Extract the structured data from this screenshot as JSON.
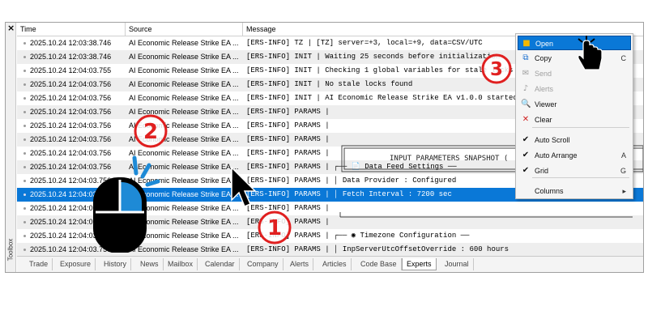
{
  "panel": {
    "close_glyph": "×",
    "toolbox_label": "Toolbox",
    "columns": {
      "time": "Time",
      "source": "Source",
      "message": "Message"
    }
  },
  "rows": [
    {
      "time": "2025.10.24 12:03:38.746",
      "source": "AI Economic Release Strike EA ...",
      "message": "[ERS-INFO] TZ | [TZ] server=+3, local=+9, data=CSV/UTC"
    },
    {
      "time": "2025.10.24 12:03:38.746",
      "source": "AI Economic Release Strike EA ...",
      "message": "[ERS-INFO] INIT | Waiting 25 seconds before initialization"
    },
    {
      "time": "2025.10.24 12:04:03.755",
      "source": "AI Economic Release Strike EA ...",
      "message": "[ERS-INFO] INIT | Checking 1 global variables for stale locks"
    },
    {
      "time": "2025.10.24 12:04:03.756",
      "source": "AI Economic Release Strike EA ...",
      "message": "[ERS-INFO] INIT | No stale locks found"
    },
    {
      "time": "2025.10.24 12:04:03.756",
      "source": "AI Economic Release Strike EA ...",
      "message": "[ERS-INFO] INIT | AI Economic Release Strike EA v1.0.0 started"
    },
    {
      "time": "2025.10.24 12:04:03.756",
      "source": "AI Economic Release Strike EA ...",
      "message": "[ERS-INFO] PARAMS |"
    },
    {
      "time": "2025.10.24 12:04:03.756",
      "source": "AI Economic Release Strike EA ...",
      "message": "[ERS-INFO] PARAMS |"
    },
    {
      "time": "2025.10.24 12:04:03.756",
      "source": "AI Economic Release Strike EA ...",
      "message": "[ERS-INFO] PARAMS |"
    },
    {
      "time": "2025.10.24 12:04:03.756",
      "source": "AI Economic Release Strike EA ...",
      "message": "[ERS-INFO] PARAMS |"
    },
    {
      "time": "2025.10.24 12:04:03.756",
      "source": "AI Economic Release Strike EA ...",
      "message": "[ERS-INFO] PARAMS |  ┌── 📄 Data Feed Settings ──"
    },
    {
      "time": "2025.10.24 12:04:03.756",
      "source": "AI Economic Release Strike EA ...",
      "message": "[ERS-INFO] PARAMS |  │ Data Provider       : Configured"
    },
    {
      "time": "2025.10.24 12:04:03.756",
      "source": "AI Economic Release Strike EA ...",
      "message": "[ERS-INFO] PARAMS |  │ Fetch Interval      : 7200 sec"
    },
    {
      "time": "2025.10.24 12:04:03.756",
      "source": "AI Economic Release Strike EA ...",
      "message": "[ERS-INFO] PARAMS |"
    },
    {
      "time": "2025.10.24 12:04:03.756",
      "source": "AI Economic Release Strike EA ...",
      "message": "[ERS-INFO] PARAMS |"
    },
    {
      "time": "2025.10.24 12:04:03.756",
      "source": "AI Economic Release Strike EA ...",
      "message": "[ERS-INFO] PARAMS |  ┌── ◉ Timezone Configuration ──"
    },
    {
      "time": "2025.10.24 12:04:03.756",
      "source": "AI Economic Release Strike EA ...",
      "message": "[ERS-INFO] PARAMS |  │ InpServerUtcOffsetOverride : 600 hours"
    }
  ],
  "selected_row": 11,
  "ascii_box_title": "INPUT PARAMETERS SNAPSHOT (",
  "tabs": [
    "Trade",
    "Exposure",
    "History",
    "News",
    "Mailbox",
    "Calendar",
    "Company",
    "Alerts",
    "Articles",
    "Code Base",
    "Experts",
    "Journal"
  ],
  "active_tab": "Experts",
  "badges": {
    "one": "①",
    "two": "②",
    "three": "③"
  },
  "context_menu": {
    "items": [
      {
        "label": "Open",
        "shortcut": "",
        "icon": "folder-icon",
        "glyph": "■",
        "color": "#f2b800",
        "state": "highlight"
      },
      {
        "label": "Copy",
        "shortcut": "C",
        "icon": "copy-icon",
        "glyph": "⧉",
        "color": "#1a6fd0",
        "state": "normal"
      },
      {
        "label": "Send",
        "shortcut": "",
        "icon": "envelope-icon",
        "glyph": "✉",
        "color": "#a0a0a0",
        "state": "disabled"
      },
      {
        "label": "Alerts",
        "shortcut": "",
        "icon": "bell-icon",
        "glyph": "♪",
        "color": "#a0a0a0",
        "state": "disabled"
      },
      {
        "label": "Viewer",
        "shortcut": "",
        "icon": "viewer-icon",
        "glyph": "🔍",
        "color": "#1a6fd0",
        "state": "normal"
      },
      {
        "label": "Clear",
        "shortcut": "",
        "icon": "clear-icon",
        "glyph": "✕",
        "color": "#d02020",
        "state": "normal"
      },
      {
        "label": "Auto Scroll",
        "shortcut": "",
        "icon": "check-icon",
        "glyph": "✔",
        "color": "#111111",
        "state": "checked"
      },
      {
        "label": "Auto Arrange",
        "shortcut": "A",
        "icon": "check-icon",
        "glyph": "✔",
        "color": "#111111",
        "state": "checked"
      },
      {
        "label": "Grid",
        "shortcut": "G",
        "icon": "check-icon",
        "glyph": "✔",
        "color": "#111111",
        "state": "checked"
      },
      {
        "label": "Columns",
        "shortcut": "▸",
        "icon": "",
        "glyph": "",
        "color": "#111111",
        "state": "submenu"
      }
    ]
  },
  "colors": {
    "selection": "#0a78d7",
    "badge_red": "#e02020",
    "mouse_blue": "#1e8ad6",
    "alt_row": "#eeeeee"
  }
}
